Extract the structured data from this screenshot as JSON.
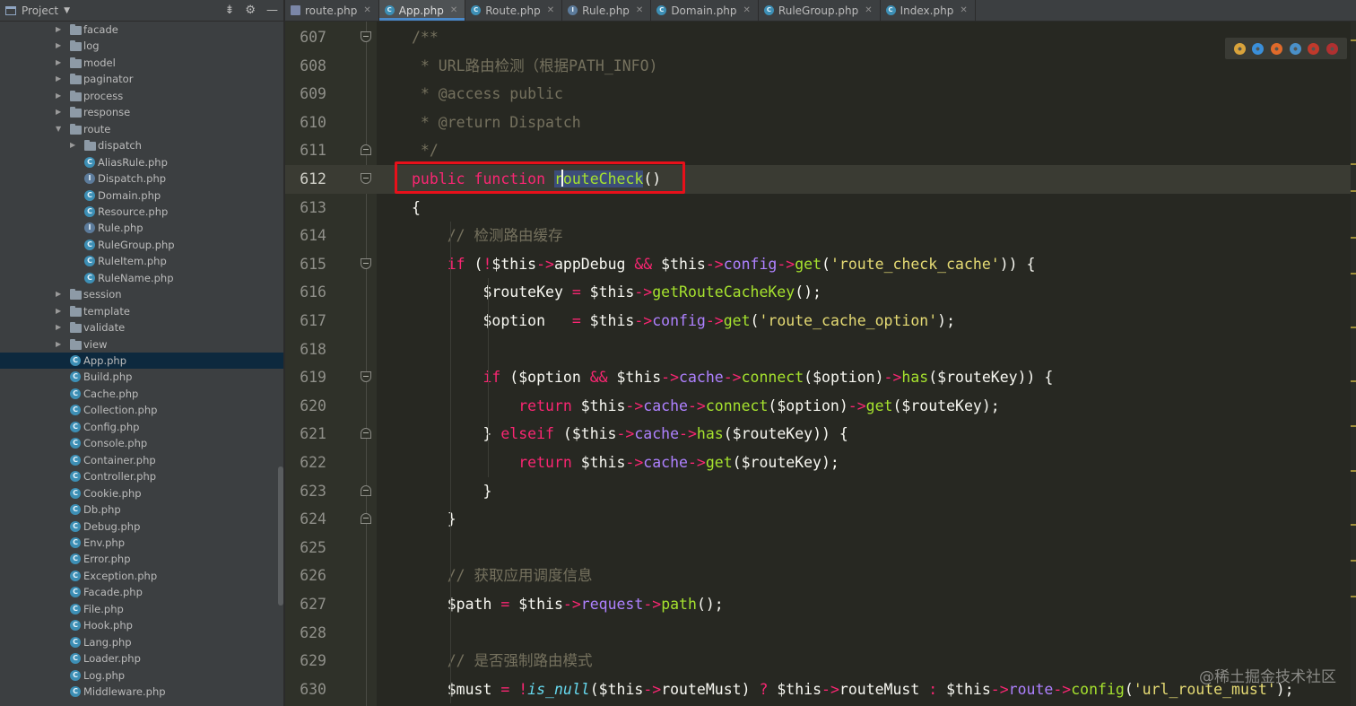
{
  "project_panel": {
    "title": "Project",
    "tree": [
      {
        "label": "facade",
        "type": "folder",
        "depth": 0,
        "expanded": false
      },
      {
        "label": "log",
        "type": "folder",
        "depth": 0,
        "expanded": false
      },
      {
        "label": "model",
        "type": "folder",
        "depth": 0,
        "expanded": false
      },
      {
        "label": "paginator",
        "type": "folder",
        "depth": 0,
        "expanded": false
      },
      {
        "label": "process",
        "type": "folder",
        "depth": 0,
        "expanded": false
      },
      {
        "label": "response",
        "type": "folder",
        "depth": 0,
        "expanded": false
      },
      {
        "label": "route",
        "type": "folder",
        "depth": 0,
        "expanded": true
      },
      {
        "label": "dispatch",
        "type": "folder",
        "depth": 1,
        "expanded": false
      },
      {
        "label": "AliasRule.php",
        "type": "class",
        "depth": 1
      },
      {
        "label": "Dispatch.php",
        "type": "interface",
        "depth": 1
      },
      {
        "label": "Domain.php",
        "type": "class",
        "depth": 1
      },
      {
        "label": "Resource.php",
        "type": "class",
        "depth": 1
      },
      {
        "label": "Rule.php",
        "type": "interface",
        "depth": 1
      },
      {
        "label": "RuleGroup.php",
        "type": "class",
        "depth": 1
      },
      {
        "label": "RuleItem.php",
        "type": "class",
        "depth": 1
      },
      {
        "label": "RuleName.php",
        "type": "class",
        "depth": 1
      },
      {
        "label": "session",
        "type": "folder",
        "depth": 0,
        "expanded": false
      },
      {
        "label": "template",
        "type": "folder",
        "depth": 0,
        "expanded": false
      },
      {
        "label": "validate",
        "type": "folder",
        "depth": 0,
        "expanded": false
      },
      {
        "label": "view",
        "type": "folder",
        "depth": 0,
        "expanded": false
      },
      {
        "label": "App.php",
        "type": "class",
        "depth": -1,
        "selected": true
      },
      {
        "label": "Build.php",
        "type": "class",
        "depth": -1
      },
      {
        "label": "Cache.php",
        "type": "class",
        "depth": -1
      },
      {
        "label": "Collection.php",
        "type": "class",
        "depth": -1
      },
      {
        "label": "Config.php",
        "type": "class",
        "depth": -1
      },
      {
        "label": "Console.php",
        "type": "class",
        "depth": -1
      },
      {
        "label": "Container.php",
        "type": "class",
        "depth": -1
      },
      {
        "label": "Controller.php",
        "type": "class",
        "depth": -1
      },
      {
        "label": "Cookie.php",
        "type": "class",
        "depth": -1
      },
      {
        "label": "Db.php",
        "type": "class",
        "depth": -1
      },
      {
        "label": "Debug.php",
        "type": "class",
        "depth": -1
      },
      {
        "label": "Env.php",
        "type": "class",
        "depth": -1
      },
      {
        "label": "Error.php",
        "type": "class",
        "depth": -1
      },
      {
        "label": "Exception.php",
        "type": "class",
        "depth": -1
      },
      {
        "label": "Facade.php",
        "type": "class",
        "depth": -1
      },
      {
        "label": "File.php",
        "type": "class",
        "depth": -1
      },
      {
        "label": "Hook.php",
        "type": "class",
        "depth": -1
      },
      {
        "label": "Lang.php",
        "type": "class",
        "depth": -1
      },
      {
        "label": "Loader.php",
        "type": "class",
        "depth": -1
      },
      {
        "label": "Log.php",
        "type": "class",
        "depth": -1
      },
      {
        "label": "Middleware.php",
        "type": "class",
        "depth": -1
      }
    ]
  },
  "tabs": [
    {
      "label": "route.php",
      "icon": "file-icon",
      "active": false
    },
    {
      "label": "App.php",
      "icon": "class-icon",
      "active": true
    },
    {
      "label": "Route.php",
      "icon": "class-icon",
      "active": false
    },
    {
      "label": "Rule.php",
      "icon": "interface-icon",
      "active": false
    },
    {
      "label": "Domain.php",
      "icon": "class-icon",
      "active": false
    },
    {
      "label": "RuleGroup.php",
      "icon": "class-icon",
      "active": false
    },
    {
      "label": "Index.php",
      "icon": "class-icon",
      "active": false
    }
  ],
  "editor": {
    "current_line": "612",
    "lines": [
      {
        "n": "607",
        "tokens": [
          [
            "com",
            "/**"
          ]
        ]
      },
      {
        "n": "608",
        "tokens": [
          [
            "com",
            " * URL路由检测（根据PATH_INFO)"
          ]
        ]
      },
      {
        "n": "609",
        "tokens": [
          [
            "com",
            " * @access public"
          ]
        ]
      },
      {
        "n": "610",
        "tokens": [
          [
            "com",
            " * @return Dispatch"
          ]
        ]
      },
      {
        "n": "611",
        "tokens": [
          [
            "com",
            " */"
          ]
        ]
      },
      {
        "n": "612",
        "tokens": [
          [
            "kw",
            "public"
          ],
          [
            "plain",
            " "
          ],
          [
            "kw",
            "function"
          ],
          [
            "plain",
            " "
          ],
          [
            "decl",
            "routeCheck"
          ],
          [
            "plain",
            "()"
          ]
        ]
      },
      {
        "n": "613",
        "tokens": [
          [
            "plain",
            "{"
          ]
        ]
      },
      {
        "n": "614",
        "tokens": [
          [
            "com",
            "    // 检测路由缓存"
          ]
        ]
      },
      {
        "n": "615",
        "tokens": [
          [
            "kw",
            "    if"
          ],
          [
            "plain",
            " ("
          ],
          [
            "op",
            "!"
          ],
          [
            "var",
            "$this"
          ],
          [
            "op",
            "->"
          ],
          [
            "plain",
            "appDebug "
          ],
          [
            "op",
            "&&"
          ],
          [
            "plain",
            " $this"
          ],
          [
            "op",
            "->"
          ],
          [
            "prop",
            "config"
          ],
          [
            "op",
            "->"
          ],
          [
            "fn",
            "get"
          ],
          [
            "plain",
            "("
          ],
          [
            "str",
            "'route_check_cache'"
          ],
          [
            "plain",
            ")) {"
          ]
        ]
      },
      {
        "n": "616",
        "tokens": [
          [
            "plain",
            "        $routeKey "
          ],
          [
            "op",
            "="
          ],
          [
            "plain",
            " $this"
          ],
          [
            "op",
            "->"
          ],
          [
            "fn",
            "getRouteCacheKey"
          ],
          [
            "plain",
            "();"
          ]
        ]
      },
      {
        "n": "617",
        "tokens": [
          [
            "plain",
            "        $option   "
          ],
          [
            "op",
            "="
          ],
          [
            "plain",
            " $this"
          ],
          [
            "op",
            "->"
          ],
          [
            "prop",
            "config"
          ],
          [
            "op",
            "->"
          ],
          [
            "fn",
            "get"
          ],
          [
            "plain",
            "("
          ],
          [
            "str",
            "'route_cache_option'"
          ],
          [
            "plain",
            ");"
          ]
        ]
      },
      {
        "n": "618",
        "tokens": []
      },
      {
        "n": "619",
        "tokens": [
          [
            "kw",
            "        if"
          ],
          [
            "plain",
            " ($option "
          ],
          [
            "op",
            "&&"
          ],
          [
            "plain",
            " $this"
          ],
          [
            "op",
            "->"
          ],
          [
            "prop",
            "cache"
          ],
          [
            "op",
            "->"
          ],
          [
            "fn",
            "connect"
          ],
          [
            "plain",
            "($option)"
          ],
          [
            "op",
            "->"
          ],
          [
            "fn",
            "has"
          ],
          [
            "plain",
            "($routeKey)) {"
          ]
        ]
      },
      {
        "n": "620",
        "tokens": [
          [
            "kw",
            "            return"
          ],
          [
            "plain",
            " $this"
          ],
          [
            "op",
            "->"
          ],
          [
            "prop",
            "cache"
          ],
          [
            "op",
            "->"
          ],
          [
            "fn",
            "connect"
          ],
          [
            "plain",
            "($option)"
          ],
          [
            "op",
            "->"
          ],
          [
            "fn",
            "get"
          ],
          [
            "plain",
            "($routeKey);"
          ]
        ]
      },
      {
        "n": "621",
        "tokens": [
          [
            "plain",
            "        } "
          ],
          [
            "kw",
            "elseif"
          ],
          [
            "plain",
            " ($this"
          ],
          [
            "op",
            "->"
          ],
          [
            "prop",
            "cache"
          ],
          [
            "op",
            "->"
          ],
          [
            "fn",
            "has"
          ],
          [
            "plain",
            "($routeKey)) {"
          ]
        ]
      },
      {
        "n": "622",
        "tokens": [
          [
            "kw",
            "            return"
          ],
          [
            "plain",
            " $this"
          ],
          [
            "op",
            "->"
          ],
          [
            "prop",
            "cache"
          ],
          [
            "op",
            "->"
          ],
          [
            "fn",
            "get"
          ],
          [
            "plain",
            "($routeKey);"
          ]
        ]
      },
      {
        "n": "623",
        "tokens": [
          [
            "plain",
            "        }"
          ]
        ]
      },
      {
        "n": "624",
        "tokens": [
          [
            "plain",
            "    }"
          ]
        ]
      },
      {
        "n": "625",
        "tokens": []
      },
      {
        "n": "626",
        "tokens": [
          [
            "com",
            "    // 获取应用调度信息"
          ]
        ]
      },
      {
        "n": "627",
        "tokens": [
          [
            "plain",
            "    $path "
          ],
          [
            "op",
            "="
          ],
          [
            "plain",
            " $this"
          ],
          [
            "op",
            "->"
          ],
          [
            "prop",
            "request"
          ],
          [
            "op",
            "->"
          ],
          [
            "fn",
            "path"
          ],
          [
            "plain",
            "();"
          ]
        ]
      },
      {
        "n": "628",
        "tokens": []
      },
      {
        "n": "629",
        "tokens": [
          [
            "com",
            "    // 是否强制路由模式"
          ]
        ]
      },
      {
        "n": "630",
        "tokens": [
          [
            "plain",
            "    $must "
          ],
          [
            "op",
            "="
          ],
          [
            "plain",
            " "
          ],
          [
            "op",
            "!"
          ],
          [
            "fnit",
            "is_null"
          ],
          [
            "plain",
            "($this"
          ],
          [
            "op",
            "->"
          ],
          [
            "plain",
            "routeMust) "
          ],
          [
            "op",
            "?"
          ],
          [
            "plain",
            " $this"
          ],
          [
            "op",
            "->"
          ],
          [
            "plain",
            "routeMust "
          ],
          [
            "op",
            ":"
          ],
          [
            "plain",
            " $this"
          ],
          [
            "op",
            "->"
          ],
          [
            "prop",
            "route"
          ],
          [
            "op",
            "->"
          ],
          [
            "fn",
            "config"
          ],
          [
            "plain",
            "("
          ],
          [
            "str",
            "'url_route_must'"
          ],
          [
            "plain",
            ");"
          ]
        ]
      }
    ]
  },
  "browser_icons": [
    {
      "name": "chrome-icon",
      "color": "#d9a33b"
    },
    {
      "name": "ie-icon",
      "color": "#3a8fd9"
    },
    {
      "name": "firefox-icon",
      "color": "#e06a2a"
    },
    {
      "name": "safari-icon",
      "color": "#4a90c8"
    },
    {
      "name": "opera-icon",
      "color": "#c0392b"
    },
    {
      "name": "opera-alt-icon",
      "color": "#b03030"
    }
  ],
  "watermark": "@稀土掘金技术社区",
  "colors": {
    "highlight_box": "#e8101a",
    "selection_bg": "#0d293e",
    "tab_accent": "#4a88c7"
  }
}
